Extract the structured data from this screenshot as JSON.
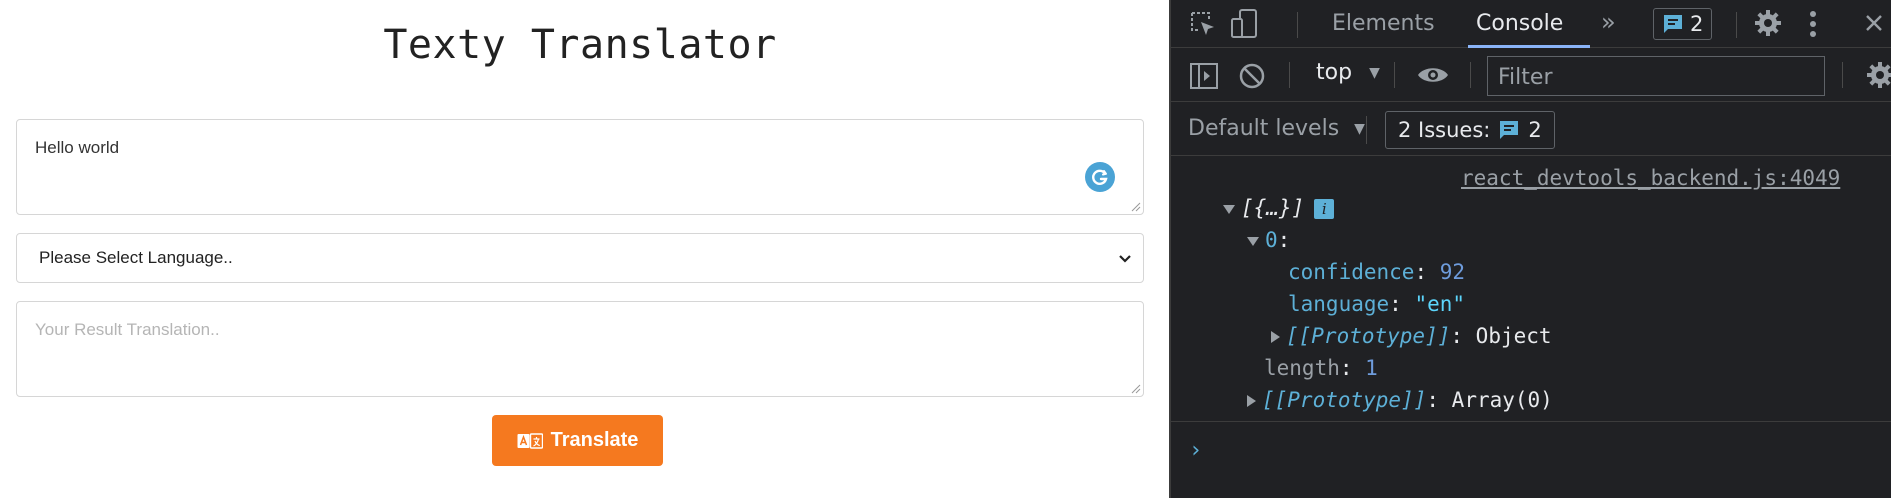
{
  "app": {
    "title": "Texty Translator",
    "input": {
      "value": "Hello world"
    },
    "language_select": {
      "selected": "Please Select Language.."
    },
    "result": {
      "placeholder": "Your Result Translation.."
    },
    "translate_button": {
      "label": "Translate"
    },
    "colors": {
      "button": "#f5791f",
      "grammarly": "#4aa3d5"
    }
  },
  "devtools": {
    "tabs": [
      {
        "label": "Elements",
        "active": false
      },
      {
        "label": "Console",
        "active": true
      }
    ],
    "message_badge": {
      "count": "2"
    },
    "context": {
      "label": "top"
    },
    "filter": {
      "placeholder": "Filter"
    },
    "levels": {
      "label": "Default levels"
    },
    "issues": {
      "prefix": "2 Issues:",
      "count": "2"
    },
    "console": {
      "source": "react_devtools_backend.js:4049",
      "array_summary": "[{…}]",
      "info_icon": "i",
      "index_key": "0",
      "confidence_key": "confidence",
      "confidence_value": "92",
      "language_key": "language",
      "language_value": "\"en\"",
      "object_proto_key": "[[Prototype]]",
      "object_proto_value": "Object",
      "length_key": "length",
      "length_value": "1",
      "array_proto_key": "[[Prototype]]",
      "array_proto_value": "Array(0)",
      "prompt": "›"
    }
  }
}
